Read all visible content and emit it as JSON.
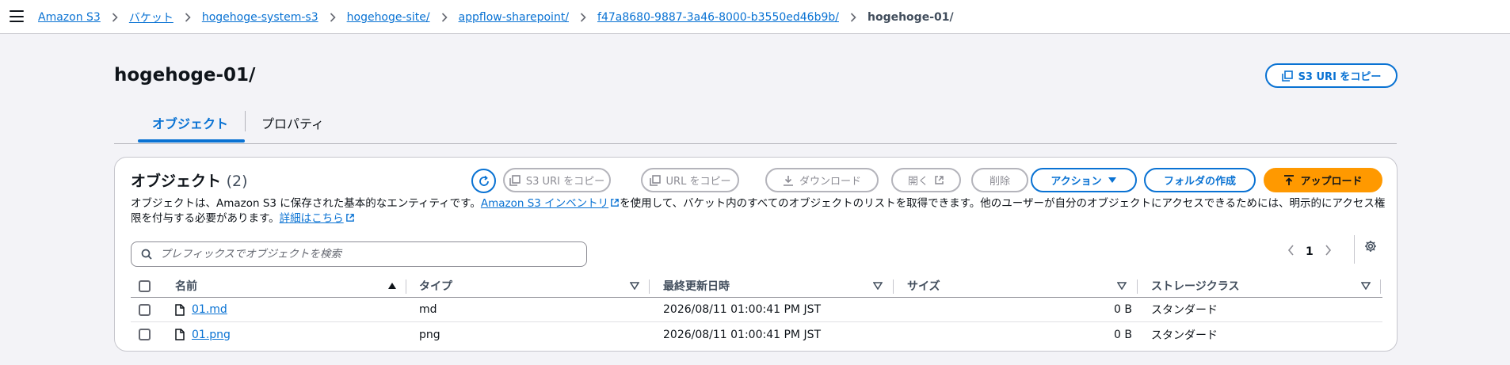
{
  "breadcrumbs": [
    {
      "label": "Amazon S3"
    },
    {
      "label": "バケット"
    },
    {
      "label": "hogehoge-system-s3"
    },
    {
      "label": "hogehoge-site/"
    },
    {
      "label": "appflow-sharepoint/"
    },
    {
      "label": "f47a8680-9887-3a46-8000-b3550ed46b9b/"
    },
    {
      "label": "hogehoge-01/"
    }
  ],
  "header": {
    "title": "hogehoge-01/",
    "copy_uri_label": "S3 URI をコピー"
  },
  "tabs": [
    {
      "label": "オブジェクト",
      "active": true
    },
    {
      "label": "プロパティ",
      "active": false
    }
  ],
  "objects_panel": {
    "title": "オブジェクト",
    "count": "(2)",
    "description": {
      "text1": "オブジェクトは、Amazon S3 に保存された基本的なエンティティです。",
      "link1": "Amazon S3 インベントリ",
      "text2": "を使用して、バケット内のすべてのオブジェクトのリストを取得できます。他のユーザーが自分のオブジェクトにアクセスできるためには、明示的にアクセス権限を付与する必要があります。",
      "link2": "詳細はこちら"
    },
    "toolbar": {
      "copy_s3_uri": "S3 URI をコピー",
      "copy_url": "URL をコピー",
      "download": "ダウンロード",
      "open": "開く",
      "delete": "削除",
      "actions": "アクション",
      "create_folder": "フォルダの作成",
      "upload": "アップロード"
    },
    "search": {
      "placeholder": "プレフィックスでオブジェクトを検索"
    },
    "pagination": {
      "current_page": "1"
    },
    "columns": [
      "名前",
      "タイプ",
      "最終更新日時",
      "サイズ",
      "ストレージクラス"
    ],
    "rows": [
      {
        "name": "01.md",
        "type": "md",
        "modified": "2026/08/11 01:00:41 PM JST",
        "size": "0 B",
        "storage_class": "スタンダード"
      },
      {
        "name": "01.png",
        "type": "png",
        "modified": "2026/08/11 01:00:41 PM JST",
        "size": "0 B",
        "storage_class": "スタンダード"
      }
    ]
  },
  "colors": {
    "accent": "#0972d3",
    "primary_button": "#ff9900",
    "disabled": "#8c8c94",
    "background": "#f3f3f7"
  }
}
